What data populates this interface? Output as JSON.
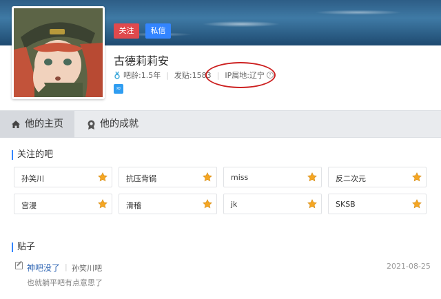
{
  "profile": {
    "follow_label": "关注",
    "message_label": "私信",
    "username": "古德莉莉安",
    "age": "吧龄:1.5年",
    "posts": "发贴:1583",
    "ip": "IP属地:辽宁",
    "ip_help": "?",
    "badge_icon": "≈"
  },
  "tabs": [
    {
      "label": "他的主页",
      "icon": "home-icon"
    },
    {
      "label": "他的成就",
      "icon": "medal-icon"
    }
  ],
  "followed": {
    "title": "关注的吧",
    "bars": [
      {
        "name": "孙笑川"
      },
      {
        "name": "抗压背锅"
      },
      {
        "name": "miss"
      },
      {
        "name": "反二次元"
      },
      {
        "name": "宫漫"
      },
      {
        "name": "滑稽"
      },
      {
        "name": "jk"
      },
      {
        "name": "SKSB"
      }
    ]
  },
  "posts_section": {
    "title": "贴子",
    "items": [
      {
        "title": "神吧没了",
        "separator": "|",
        "bar": "孙笑川吧",
        "date": "2021-08-25",
        "excerpt": "也就躺平吧有点意思了"
      }
    ]
  },
  "colors": {
    "follow": "#e0494d",
    "message": "#3385ff",
    "star": "#f5a623",
    "link": "#2d64b3",
    "highlight_circle": "#cc1f1f"
  }
}
